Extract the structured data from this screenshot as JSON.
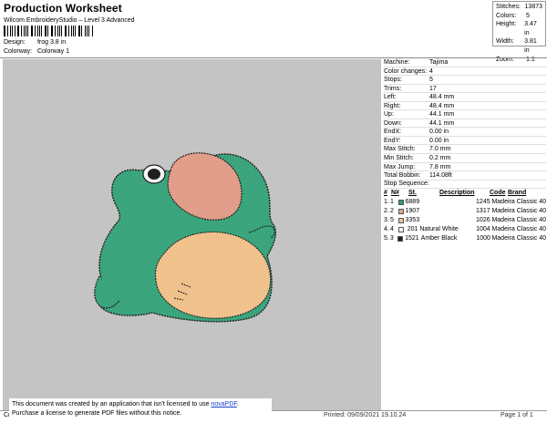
{
  "header": {
    "title": "Production Worksheet",
    "subtitle": "Wilcom EmbroideryStudio – Level 3 Advanced",
    "design_label": "Design:",
    "design_value": "frog 3.8 in",
    "colorway_label": "Colorway:",
    "colorway_value": "Colorway 1"
  },
  "stats": [
    {
      "k": "Stitches:",
      "v": "13873"
    },
    {
      "k": "Colors:",
      "v": "5"
    },
    {
      "k": "Height:",
      "v": "3.47 in"
    },
    {
      "k": "Width:",
      "v": "3.81 in"
    },
    {
      "k": "Zoom:",
      "v": "1:1"
    }
  ],
  "info": [
    {
      "k": "Machine:",
      "v": "Tajima"
    },
    {
      "k": "Color changes:",
      "v": "4"
    },
    {
      "k": "Stops:",
      "v": "5"
    },
    {
      "k": "Trims:",
      "v": "17"
    },
    {
      "k": "Left:",
      "v": "48.4 mm"
    },
    {
      "k": "Right:",
      "v": "48.4 mm"
    },
    {
      "k": "Up:",
      "v": "44.1 mm"
    },
    {
      "k": "Down:",
      "v": "44.1 mm"
    },
    {
      "k": "EndX:",
      "v": "0.00 in"
    },
    {
      "k": "EndY:",
      "v": "0.00 in"
    },
    {
      "k": "Max Stitch:",
      "v": "7.0 mm"
    },
    {
      "k": "Min Stitch:",
      "v": "0.2 mm"
    },
    {
      "k": "Max Jump:",
      "v": "7.8 mm"
    },
    {
      "k": "Total Bobbin:",
      "v": "114.08ft"
    }
  ],
  "stop_sequence": {
    "label": "Stop Sequence:",
    "headers": [
      "#",
      "N#",
      "St.",
      "Description",
      "Code",
      "Brand"
    ],
    "rows": [
      {
        "n": "1.",
        "nn": "1",
        "color": "#2a9d7a",
        "st": "6889",
        "desc": "",
        "code": "1245",
        "brand": "Madeira Classic 40"
      },
      {
        "n": "2.",
        "nn": "2",
        "color": "#e3a08c",
        "st": "1907",
        "desc": "",
        "code": "1317",
        "brand": "Madeira Classic 40"
      },
      {
        "n": "3.",
        "nn": "5",
        "color": "#f2c48f",
        "st": "3353",
        "desc": "",
        "code": "1026",
        "brand": "Madeira Classic 40"
      },
      {
        "n": "4.",
        "nn": "4",
        "color": "#f5f5f5",
        "st": "201",
        "desc": "Natural White",
        "code": "1004",
        "brand": "Madeira Classic 40"
      },
      {
        "n": "5.",
        "nn": "3",
        "color": "#1e1e1e",
        "st": "1521",
        "desc": "Amber Black",
        "code": "1000",
        "brand": "Madeira Classic 40"
      }
    ]
  },
  "notice": {
    "line1_pre": "This document was created by an application that isn't licensed to use ",
    "line1_link": "novaPDF",
    "line1_post": ".",
    "line2": "Purchase a license to generate PDF files without this notice."
  },
  "footer": {
    "left": "Cr",
    "printed": "Printed: 09/09/2021 19.10.24",
    "page": "Page 1 of 1"
  },
  "colors": {
    "canvas": "#c4c4c4",
    "frog_body": "#3da880",
    "frog_mouth": "#e3a08c",
    "frog_belly": "#f2c48f",
    "outline": "#1e1e1e"
  }
}
